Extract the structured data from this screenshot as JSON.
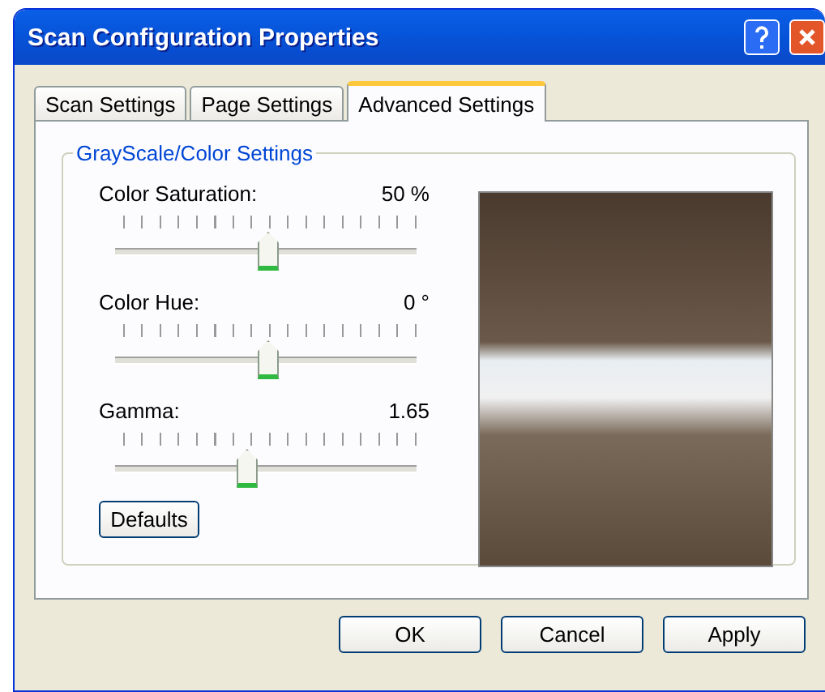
{
  "window": {
    "title": "Scan Configuration Properties"
  },
  "tabs": [
    {
      "label": "Scan Settings",
      "selected": false
    },
    {
      "label": "Page Settings",
      "selected": false
    },
    {
      "label": "Advanced Settings",
      "selected": true
    }
  ],
  "group": {
    "title": "GrayScale/Color Settings"
  },
  "sliders": [
    {
      "label": "Color Saturation:",
      "reading": "50 %",
      "level": 0.5
    },
    {
      "label": "Color Hue:",
      "reading": "0 °",
      "level": 0.5
    },
    {
      "label": "Gamma:",
      "reading": "1.65",
      "level": 0.43
    }
  ],
  "defaults_button": "Defaults",
  "buttons": [
    "OK",
    "Cancel",
    "Apply"
  ]
}
